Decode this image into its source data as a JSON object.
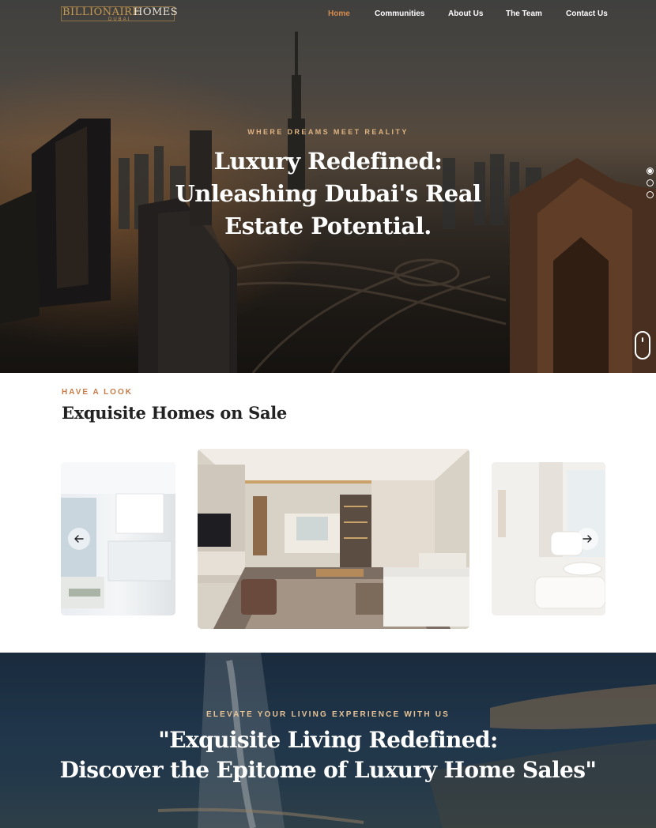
{
  "header": {
    "logo": {
      "word1": "BILLIONAIRE",
      "word2": "HOMES",
      "sub": "DUBAI"
    },
    "nav": [
      {
        "label": "Home",
        "active": true
      },
      {
        "label": "Communities",
        "active": false
      },
      {
        "label": "About Us",
        "active": false
      },
      {
        "label": "The Team",
        "active": false
      },
      {
        "label": "Contact Us",
        "active": false
      }
    ]
  },
  "hero": {
    "kicker": "WHERE DREAMS MEET REALITY",
    "title": "Luxury Redefined: Unleashing Dubai's Real Estate Potential.",
    "pagination": {
      "total": 3,
      "active": 1
    }
  },
  "homes": {
    "kicker": "HAVE A LOOK",
    "title": "Exquisite Homes on Sale"
  },
  "cta": {
    "kicker": "ELEVATE YOUR LIVING EXPERIENCE WITH US",
    "title_line1": "\"Exquisite Living Redefined:",
    "title_line2": "Discover the Epitome of Luxury Home Sales\""
  },
  "colors": {
    "accent": "#d68b4e",
    "kicker_gold": "#e0b483",
    "section_accent": "#c87b46",
    "text_dark": "#222222"
  }
}
